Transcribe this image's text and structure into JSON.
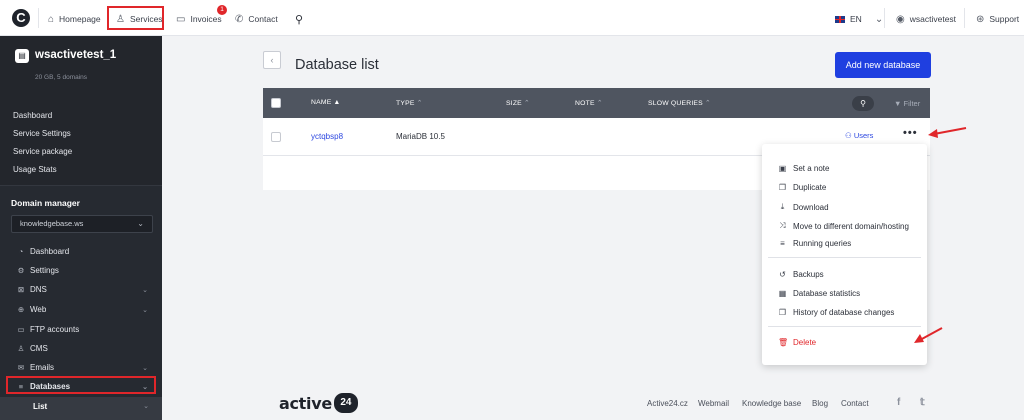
{
  "topbar": {
    "logo": "C",
    "nav": [
      {
        "label": "Homepage",
        "icon": "home-icon"
      },
      {
        "label": "Services",
        "icon": "services-icon"
      },
      {
        "label": "Invoices",
        "icon": "invoice-icon",
        "badge": "1"
      },
      {
        "label": "Contact",
        "icon": "phone-icon"
      }
    ],
    "language": "EN",
    "username": "wsactivetest",
    "support": "Support"
  },
  "sidebar": {
    "account_name": "wsactivetest_1",
    "account_sub": "20 GB, 5 domains",
    "links": [
      "Dashboard",
      "Service Settings",
      "Service package",
      "Usage Stats"
    ],
    "domain_manager_title": "Domain manager",
    "domain_select": "knowledgebase.ws",
    "items": [
      {
        "label": "Dashboard",
        "icon": "dashboard-icon",
        "expandable": false
      },
      {
        "label": "Settings",
        "icon": "gear-icon",
        "expandable": false
      },
      {
        "label": "DNS",
        "icon": "dns-icon",
        "expandable": true
      },
      {
        "label": "Web",
        "icon": "globe-icon",
        "expandable": true
      },
      {
        "label": "FTP accounts",
        "icon": "folder-icon",
        "expandable": false
      },
      {
        "label": "CMS",
        "icon": "cms-icon",
        "expandable": false
      },
      {
        "label": "Emails",
        "icon": "mail-icon",
        "expandable": true
      },
      {
        "label": "Databases",
        "icon": "database-icon",
        "expandable": true
      }
    ],
    "sub_item": "List"
  },
  "main": {
    "title": "Database list",
    "add_button": "Add new database",
    "columns": [
      "NAME",
      "TYPE",
      "SIZE",
      "NOTE",
      "SLOW QUERIES"
    ],
    "filter_label": "Filter",
    "rows": [
      {
        "name": "yctqbsp8",
        "type": "MariaDB 10.5",
        "users_label": "Users"
      }
    ]
  },
  "context_menu": {
    "group1": [
      {
        "label": "Set a note",
        "icon": "note-icon"
      },
      {
        "label": "Duplicate",
        "icon": "copy-icon"
      },
      {
        "label": "Download",
        "icon": "download-icon"
      },
      {
        "label": "Move to different domain/hosting",
        "icon": "shuffle-icon"
      },
      {
        "label": "Running queries",
        "icon": "database-icon"
      }
    ],
    "group2": [
      {
        "label": "Backups",
        "icon": "history-icon"
      },
      {
        "label": "Database statistics",
        "icon": "chart-icon"
      },
      {
        "label": "History of database changes",
        "icon": "copy-icon"
      }
    ],
    "delete_label": "Delete"
  },
  "footer": {
    "logo_text": "active",
    "logo_badge": "24",
    "links": [
      "Active24.cz",
      "Webmail",
      "Knowledge base",
      "Blog",
      "Contact"
    ]
  },
  "colors": {
    "accent": "#1f3fe0",
    "danger": "#e0262a",
    "sidebar": "#262a31"
  }
}
